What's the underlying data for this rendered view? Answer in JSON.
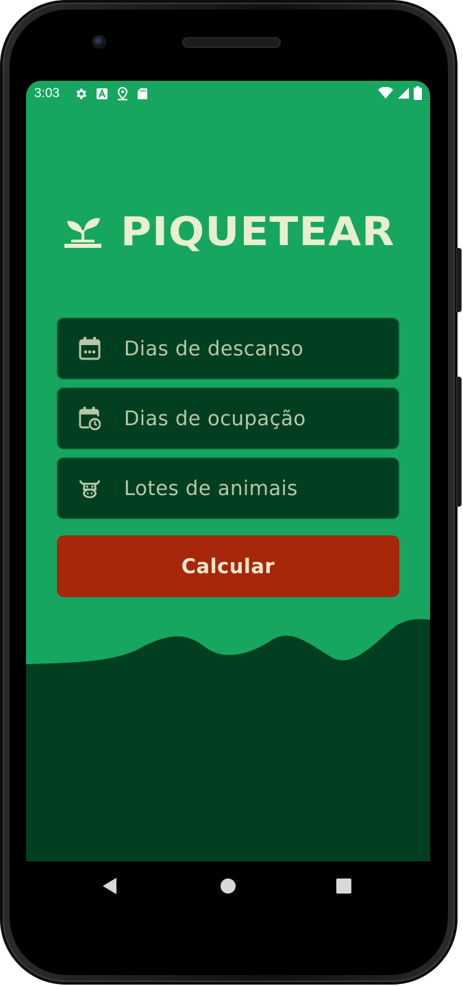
{
  "statusbar": {
    "time": "3:03",
    "left_icons": [
      "settings-icon",
      "text-a-icon",
      "location-icon",
      "sd-card-icon"
    ],
    "right_icons": [
      "wifi-icon",
      "signal-icon",
      "battery-icon"
    ]
  },
  "app": {
    "logo_icon": "sprout-icon",
    "title": "PIQUETEAR",
    "colors": {
      "background": "#17a65f",
      "field_background": "#023f21",
      "button": "#a6270a",
      "logo_text": "#e8efcf",
      "wave": "#023f21"
    }
  },
  "form": {
    "fields": [
      {
        "icon": "calendar-icon",
        "placeholder": "Dias de descanso"
      },
      {
        "icon": "calendar-clock-icon",
        "placeholder": "Dias de ocupação"
      },
      {
        "icon": "cow-icon",
        "placeholder": "Lotes de animais"
      }
    ],
    "submit_label": "Calcular"
  },
  "navbar": {
    "buttons": [
      "back-icon",
      "home-icon",
      "recents-icon"
    ]
  }
}
